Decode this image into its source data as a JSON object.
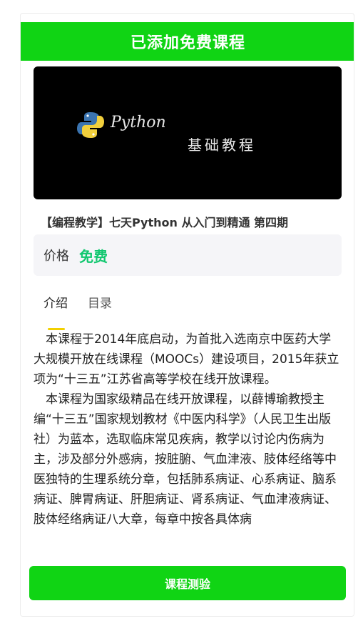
{
  "header": {
    "title": "已添加免费课程"
  },
  "banner": {
    "logo_icon": "python-logo-icon",
    "word": "Python",
    "subtitle": "基础教程"
  },
  "course": {
    "title": "【编程教学】七天Python 从入门到精通 第四期",
    "price_label": "价格",
    "price_value": "免费"
  },
  "tabs": [
    {
      "label": "介绍",
      "active": true
    },
    {
      "label": "目录",
      "active": false
    }
  ],
  "content": {
    "paragraphs": [
      "本课程于2014年底启动，为首批入选南京中医药大学大规模开放在线课程（MOOCs）建设项目，2015年获立项为“十三五”江苏省高等学校在线开放课程。",
      "本课程为国家级精品在线开放课程，以薛博瑜教授主编“十三五”国家规划教材《中医内科学》（人民卫生出版社）为蓝本，选取临床常见疾病，教学以讨论内伤病为主，涉及部分外感病，按脏腑、气血津液、肢体经络等中医独特的生理系统分章，包括肺系病证、心系病证、脑系病证、脾胃病证、肝胆病证、肾系病证、气血津液病证、肢体经络病证八大章，每章中按各具体病"
    ]
  },
  "footer": {
    "button_label": "课程测验"
  },
  "colors": {
    "accent": "#10d414",
    "price": "#11c76f",
    "tab_indicator": "#f2d000"
  }
}
